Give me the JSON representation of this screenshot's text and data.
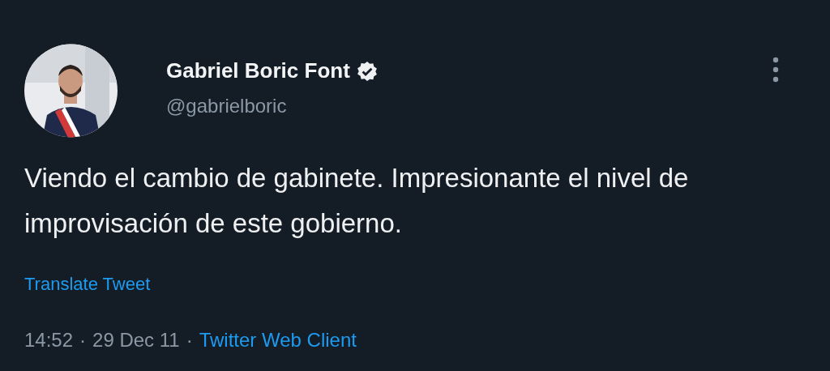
{
  "tweet": {
    "author_name": "Gabriel Boric Font",
    "verified": true,
    "handle": "@gabrielboric",
    "text": "Viendo el cambio de gabinete. Impresionante el nivel de improvisación de este gobierno.",
    "translate_link": "Translate Tweet",
    "time": "14:52",
    "separator_1": "·",
    "date": "29 Dec 11",
    "separator_2": "·",
    "source": "Twitter Web Client"
  }
}
